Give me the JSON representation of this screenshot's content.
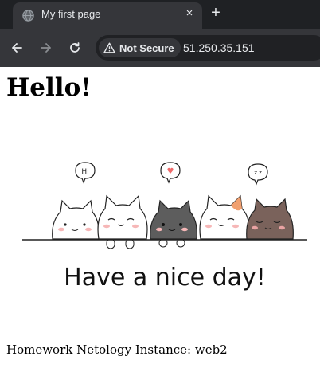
{
  "browser": {
    "tab": {
      "title": "My first page",
      "close_glyph": "×",
      "favicon": "globe-icon"
    },
    "new_tab_glyph": "+",
    "toolbar": {
      "back_icon": "arrow-left-icon",
      "forward_icon": "arrow-right-icon",
      "reload_icon": "reload-icon"
    },
    "omnibox": {
      "security_label": "Not Secure",
      "security_icon": "warning-triangle-icon",
      "url": "51.250.35.151"
    }
  },
  "page": {
    "heading": "Hello!",
    "illustration": {
      "bubbles": [
        "Hi",
        "♥",
        "z z"
      ],
      "message": "Have a nice day!"
    },
    "caption": "Homework Netology Instance: web2"
  },
  "colors": {
    "tab_strip": "#1f2124",
    "toolbar": "#35363a",
    "omnibox": "#202124",
    "heart": "#ef6b6b"
  }
}
